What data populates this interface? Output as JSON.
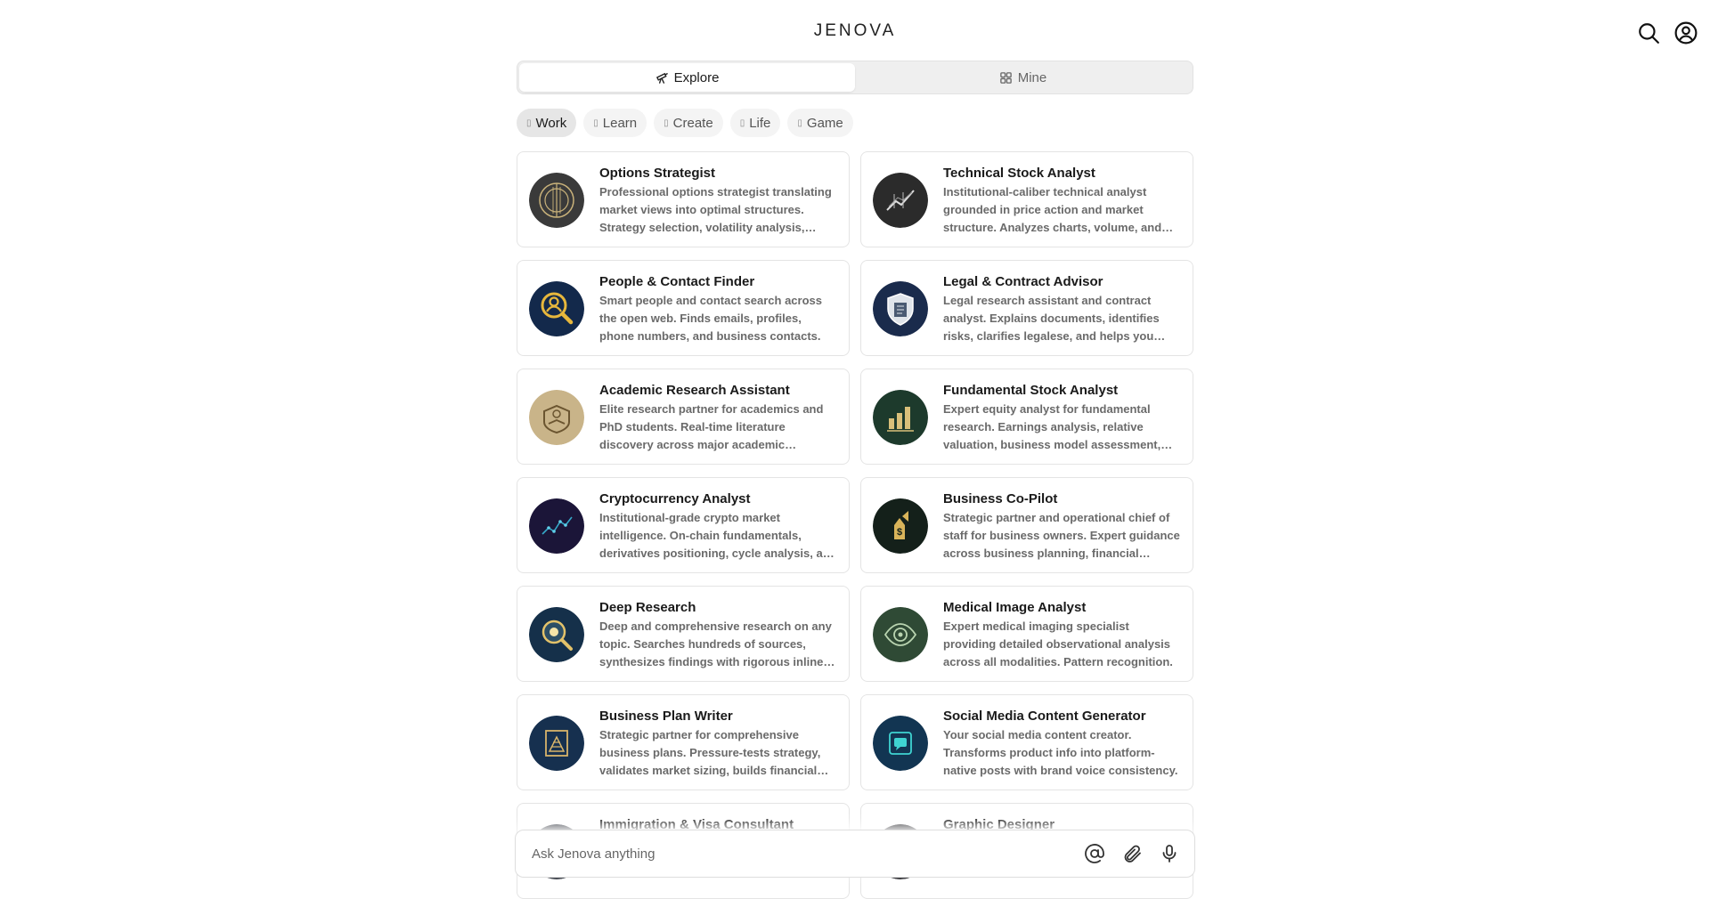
{
  "header": {
    "brand": "JENOVA",
    "icons": [
      "search-icon",
      "account-icon"
    ]
  },
  "tabs": [
    {
      "label": "Explore",
      "icon": "telescope-icon",
      "active": true
    },
    {
      "label": "Mine",
      "icon": "grid-icon",
      "active": false
    }
  ],
  "categories": [
    {
      "label": "Work",
      "active": true
    },
    {
      "label": "Learn",
      "active": false
    },
    {
      "label": "Create",
      "active": false
    },
    {
      "label": "Life",
      "active": false
    },
    {
      "label": "Game",
      "active": false
    }
  ],
  "cards": [
    {
      "title": "Options Strategist",
      "desc": "Professional options strategist translating market views into optimal structures. Strategy selection, volatility analysis, Greeks and risk management.",
      "color": "#3a3a3a"
    },
    {
      "title": "Technical Stock Analyst",
      "desc": "Institutional-caliber technical analyst grounded in price action and market structure. Analyzes charts, volume, and momentum.",
      "color": "#2b2b2b"
    },
    {
      "title": "People & Contact Finder",
      "desc": "Smart people and contact search across the open web. Finds emails, profiles, phone numbers, and business contacts.",
      "color": "#13294b"
    },
    {
      "title": "Legal & Contract Advisor",
      "desc": "Legal research assistant and contract analyst. Explains documents, identifies risks, clarifies legalese, and helps you negotiate.",
      "color": "#1a2b4c"
    },
    {
      "title": "Academic Research Assistant",
      "desc": "Elite research partner for academics and PhD students. Real-time literature discovery across major academic databases.",
      "color": "#c9b489"
    },
    {
      "title": "Fundamental Stock Analyst",
      "desc": "Expert equity analyst for fundamental research. Earnings analysis, relative valuation, business model assessment, and more.",
      "color": "#1d3a2c"
    },
    {
      "title": "Cryptocurrency Analyst",
      "desc": "Institutional-grade crypto market intelligence. On-chain fundamentals, derivatives positioning, cycle analysis, and more.",
      "color": "#1b1538"
    },
    {
      "title": "Business Co-Pilot",
      "desc": "Strategic partner and operational chief of staff for business owners. Expert guidance across business planning, financial strategy.",
      "color": "#14201a"
    },
    {
      "title": "Deep Research",
      "desc": "Deep and comprehensive research on any topic. Searches hundreds of sources, synthesizes findings with rigorous inline citations.",
      "color": "#15304a"
    },
    {
      "title": "Medical Image Analyst",
      "desc": "Expert medical imaging specialist providing detailed observational analysis across all modalities. Pattern recognition.",
      "color": "#2f4a35"
    },
    {
      "title": "Business Plan Writer",
      "desc": "Strategic partner for comprehensive business plans. Pressure-tests strategy, validates market sizing, builds financial models.",
      "color": "#16304f"
    },
    {
      "title": "Social Media Content Generator",
      "desc": "Your social media content creator. Transforms product info into platform-native posts with brand voice consistency.",
      "color": "#123552"
    },
    {
      "title": "Immigration & Visa Consultant",
      "desc": "",
      "color": "#2a2f38"
    },
    {
      "title": "Graphic Designer",
      "desc": "",
      "color": "#1f1f24"
    }
  ],
  "prompt": {
    "placeholder": "Ask Jenova anything",
    "icons": [
      "at-mention-icon",
      "paperclip-icon",
      "microphone-icon"
    ]
  }
}
